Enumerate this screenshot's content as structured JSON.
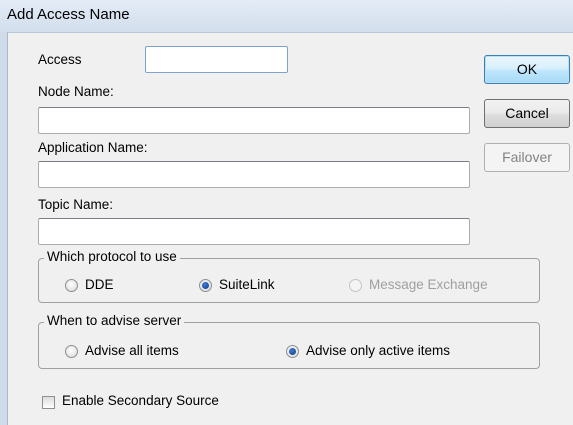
{
  "window": {
    "title": "Add Access Name"
  },
  "fields": {
    "access_label": "Access",
    "access_value": "",
    "node_name_label": "Node Name:",
    "node_name_value": "",
    "application_name_label": "Application Name:",
    "application_name_value": "",
    "topic_name_label": "Topic Name:",
    "topic_name_value": ""
  },
  "buttons": {
    "ok": "OK",
    "cancel": "Cancel",
    "failover": "Failover"
  },
  "protocol": {
    "legend": "Which protocol to use",
    "options": [
      {
        "label": "DDE",
        "checked": false,
        "enabled": true
      },
      {
        "label": "SuiteLink",
        "checked": true,
        "enabled": true
      },
      {
        "label": "Message Exchange",
        "checked": false,
        "enabled": false
      }
    ]
  },
  "advise": {
    "legend": "When to advise server",
    "options": [
      {
        "label": "Advise all items",
        "checked": false,
        "enabled": true
      },
      {
        "label": "Advise only active items",
        "checked": true,
        "enabled": true
      }
    ]
  },
  "secondary": {
    "label": "Enable Secondary Source",
    "checked": false
  }
}
